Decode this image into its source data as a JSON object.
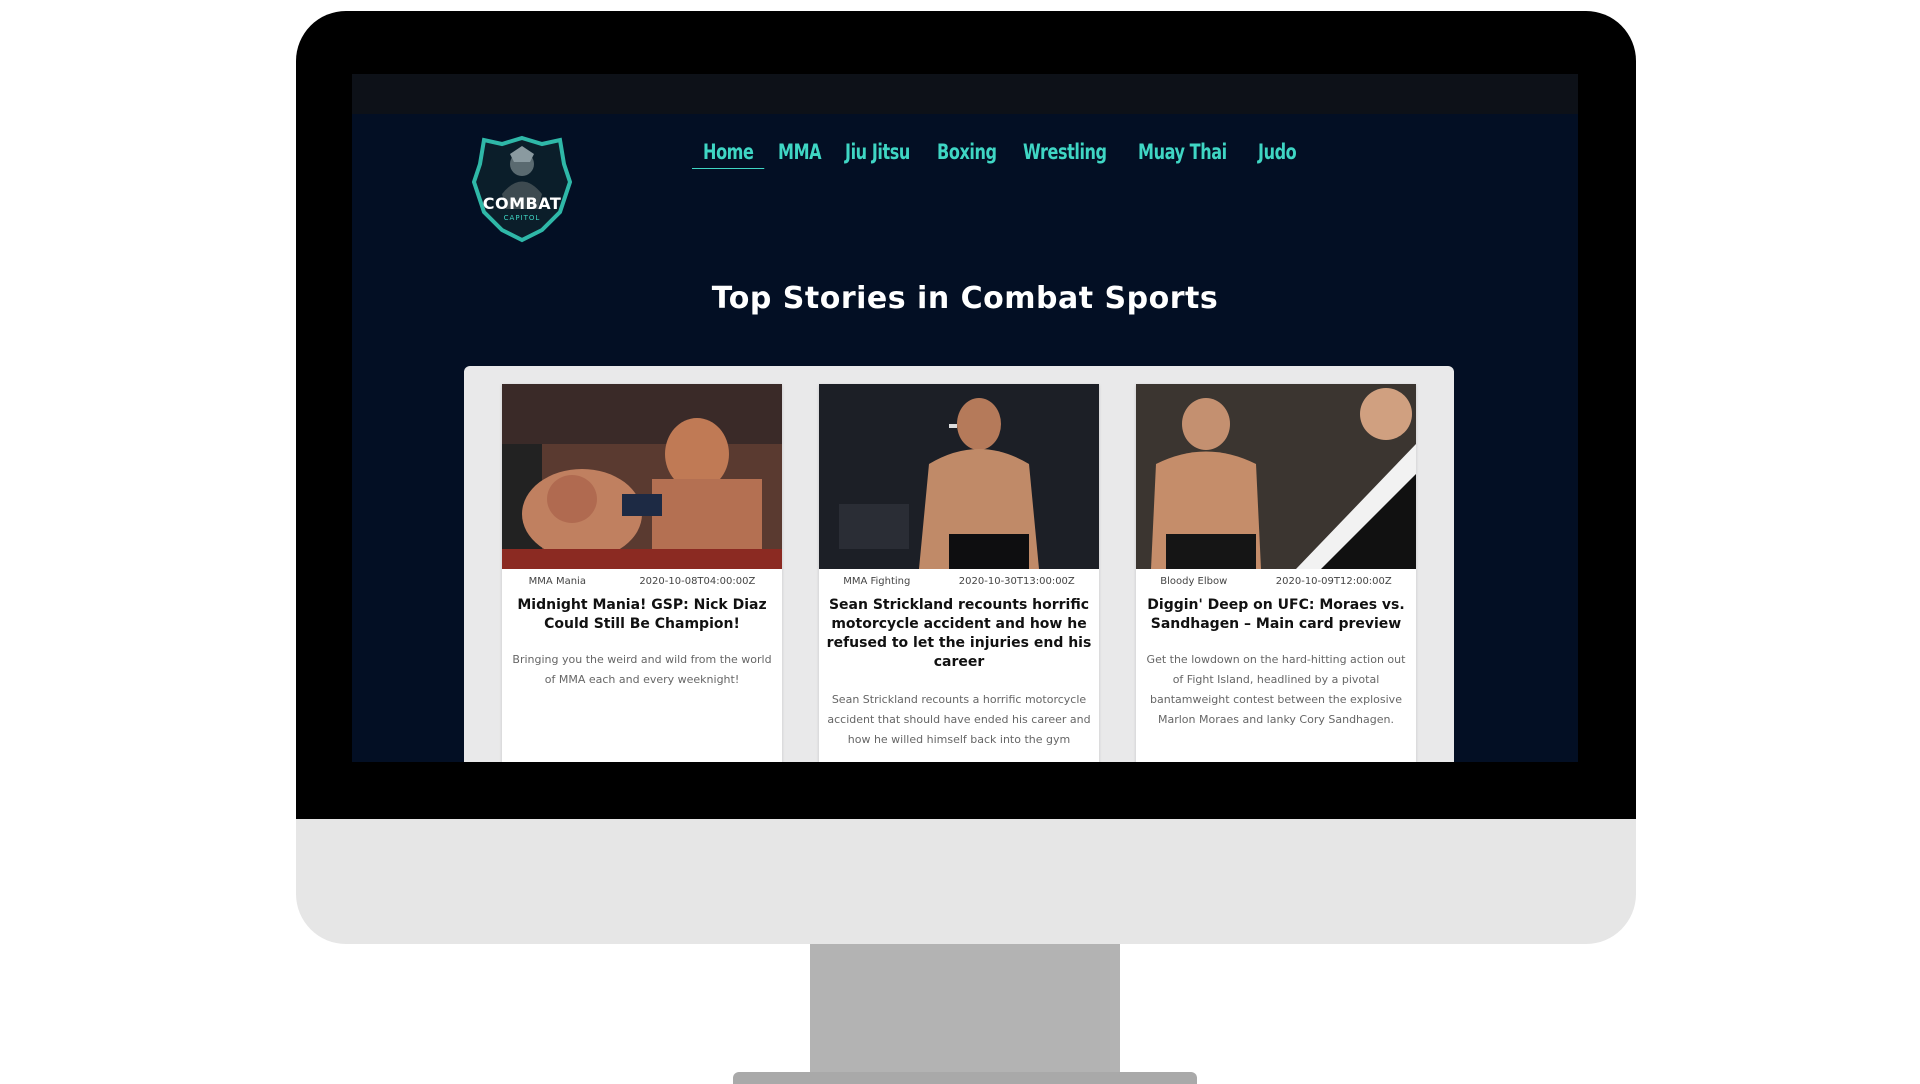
{
  "site": {
    "logo": {
      "text": "COMBAT",
      "subtext": "CAPITOL"
    },
    "nav": [
      {
        "label": "Home",
        "active": true
      },
      {
        "label": "MMA",
        "active": false
      },
      {
        "label": "Jiu Jitsu",
        "active": false
      },
      {
        "label": "Boxing",
        "active": false
      },
      {
        "label": "Wrestling",
        "active": false
      },
      {
        "label": "Muay Thai",
        "active": false
      },
      {
        "label": "Judo",
        "active": false
      }
    ],
    "hero_title": "Top Stories in Combat Sports"
  },
  "stories": [
    {
      "source": "MMA Mania",
      "date": "2020-10-08T04:00:00Z",
      "title": "Midnight Mania! GSP: Nick Diaz Could Still Be Champion!",
      "description": "Bringing you the weird and wild from the world of MMA each and every weeknight!"
    },
    {
      "source": "MMA Fighting",
      "date": "2020-10-30T13:00:00Z",
      "title": "Sean Strickland recounts horrific motorcycle accident and how he refused to let the injuries end his career",
      "description": "Sean Strickland recounts a horrific motorcycle accident that should have ended his career and how he willed himself back into the gym"
    },
    {
      "source": "Bloody Elbow",
      "date": "2020-10-09T12:00:00Z",
      "title": "Diggin' Deep on UFC: Moraes vs. Sandhagen – Main card preview",
      "description": "Get the lowdown on the hard-hitting action out of Fight Island, headlined by a pivotal bantamweight contest between the explosive Marlon Moraes and lanky Cory Sandhagen."
    }
  ],
  "colors": {
    "screen_bg": "#030f24",
    "accent": "#3fd6c4",
    "panel_bg": "#e9e9ea"
  }
}
